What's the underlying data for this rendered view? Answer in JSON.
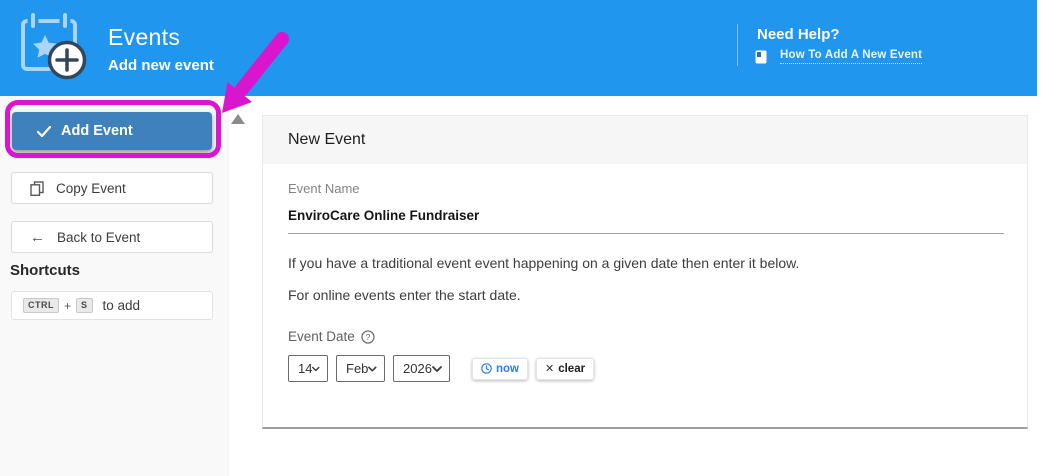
{
  "header": {
    "title": "Events",
    "subtitle": "Add new event",
    "need_help": "Need Help?",
    "help_link": "How To Add A New Event"
  },
  "sidebar": {
    "add_event_label": "Add Event",
    "copy_event_label": "Copy Event",
    "back_to_event_label": "Back to Event",
    "shortcuts_title": "Shortcuts",
    "shortcut_key_1": "CTRL",
    "shortcut_plus": "+",
    "shortcut_key_2": "S",
    "shortcut_action": "to add"
  },
  "panel": {
    "title": "New Event",
    "event_name": {
      "label": "Event Name",
      "value": "EnviroCare Online Fundraiser"
    },
    "description_line_1": "If you have a traditional event event happening on a given date then enter it below.",
    "description_line_2": "For online events enter the start date.",
    "event_date": {
      "label": "Event Date",
      "day": "14",
      "month": "Feb",
      "year": "2026",
      "now_label": "now",
      "clear_label": "clear"
    }
  },
  "annotation": {
    "type": "highlight-box-with-arrow",
    "target": "Add Event button",
    "color": "#d916ce"
  },
  "colors": {
    "header_blue": "#2196ee",
    "add_event_button_blue": "#3f81bb",
    "annotation_magenta": "#d916ce",
    "link_blue": "#2b7de9"
  }
}
